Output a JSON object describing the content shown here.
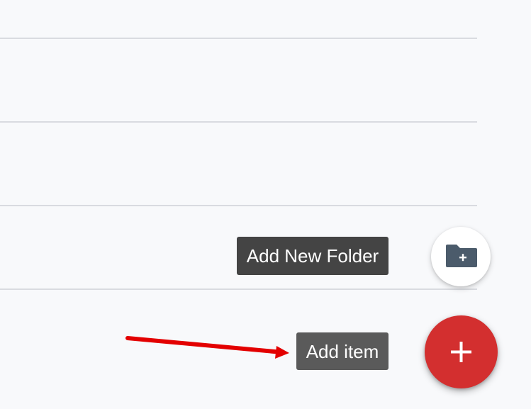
{
  "list": {
    "rows": [
      "",
      "",
      "",
      "",
      ""
    ]
  },
  "speed_dial": {
    "folder_tooltip": "Add New Folder",
    "item_tooltip": "Add item",
    "folder_icon": "folder-plus-icon",
    "main_icon": "plus-icon",
    "accent_color": "#d32f2f",
    "folder_icon_color": "#4b5b6b"
  },
  "annotation": {
    "arrow_color": "#e30000"
  }
}
